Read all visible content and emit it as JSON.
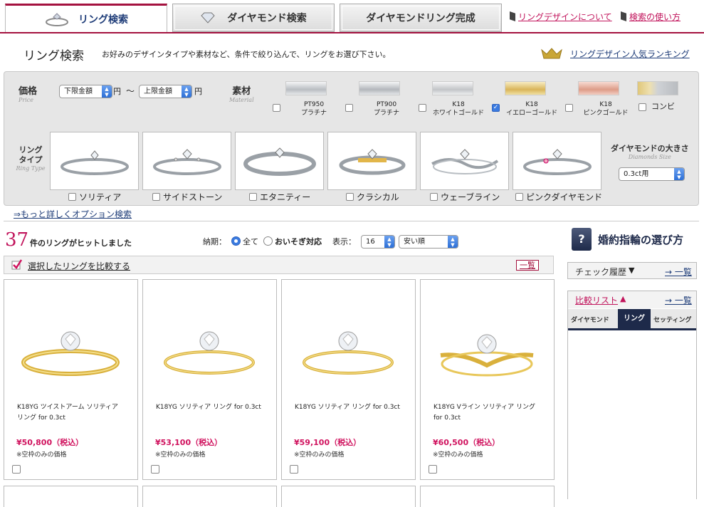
{
  "tabs": [
    {
      "label": "リング検索",
      "active": true
    },
    {
      "label": "ダイヤモンド検索",
      "active": false
    },
    {
      "label": "ダイヤモンドリング完成",
      "active": false
    }
  ],
  "top_links": [
    "リングデザインについて",
    "検索の使い方"
  ],
  "header": {
    "title": "リング検索",
    "description": "お好みのデザインタイプや素材など、条件で絞り込んで、リングをお選び下さい。",
    "ranking_link": "リングデザイン人気ランキング"
  },
  "search": {
    "price_label": "価格",
    "price_sub": "Price",
    "min_select": "下限金額",
    "max_select": "上限金額",
    "yen": "円",
    "tilde": "〜",
    "material_label": "素材",
    "material_sub": "Material",
    "materials": [
      {
        "line1": "PT950",
        "line2": "プラチナ",
        "checked": false,
        "color": "#c9ccd0"
      },
      {
        "line1": "PT900",
        "line2": "プラチナ",
        "checked": false,
        "color": "#c4c7cb"
      },
      {
        "line1": "K18",
        "line2": "ホワイトゴールド",
        "checked": false,
        "color": "#d2d4d6"
      },
      {
        "line1": "K18",
        "line2": "イエローゴールド",
        "checked": true,
        "color": "#e8cf7e"
      },
      {
        "line1": "K18",
        "line2": "ピンクゴールド",
        "checked": false,
        "color": "#e9b4a4"
      },
      {
        "line1": "コンビ",
        "line2": "",
        "checked": false,
        "color": "#d8d0b0"
      }
    ],
    "ringtype_label_1": "リング",
    "ringtype_label_2": "タイプ",
    "ringtype_sub": "Ring Type",
    "ring_types": [
      {
        "label": "ソリティア"
      },
      {
        "label": "サイドストーン"
      },
      {
        "label": "エタニティー"
      },
      {
        "label": "クラシカル"
      },
      {
        "label": "ウェーブライン"
      },
      {
        "label": "ピンクダイヤモンド"
      }
    ],
    "diamond_size_label": "ダイヤモンドの大きさ",
    "diamond_size_sub": "Diamonds Size",
    "diamond_size_value": "0.3ct用",
    "more_options": "⇒もっと詳しくオプション検索"
  },
  "results": {
    "count": "37",
    "count_text": "件のリングがヒットしました",
    "delivery_label": "納期：",
    "delivery_all": "全て",
    "delivery_rush": "おいそぎ対応",
    "show_label": "表示：",
    "show_value": "16",
    "sort_value": "安い順",
    "compare_text": "選択したリングを比較する",
    "list_btn": "一覧"
  },
  "products": [
    {
      "name": "K18YG ツイストアーム ソリティアリング for 0.3ct",
      "price": "¥50,800（税込）",
      "note": "※空枠のみの価格"
    },
    {
      "name": "K18YG ソリティア リング for 0.3ct",
      "price": "¥53,100（税込）",
      "note": "※空枠のみの価格"
    },
    {
      "name": "K18YG ソリティア リング for 0.3ct",
      "price": "¥59,100（税込）",
      "note": "※空枠のみの価格"
    },
    {
      "name": "K18YG Vライン ソリティア リング for 0.3ct",
      "price": "¥60,500（税込）",
      "note": "※空枠のみの価格"
    }
  ],
  "sidebar": {
    "help_icon": "?",
    "title": "婚約指輪の選び方",
    "check_history": "チェック履歴",
    "check_arrow": "▼",
    "check_link": "→ 一覧",
    "compare_list": "比較リスト",
    "compare_arrow": "▲",
    "compare_link": "→ 一覧",
    "tabs": [
      "ダイヤモンド",
      "リング",
      "セッティング"
    ]
  }
}
